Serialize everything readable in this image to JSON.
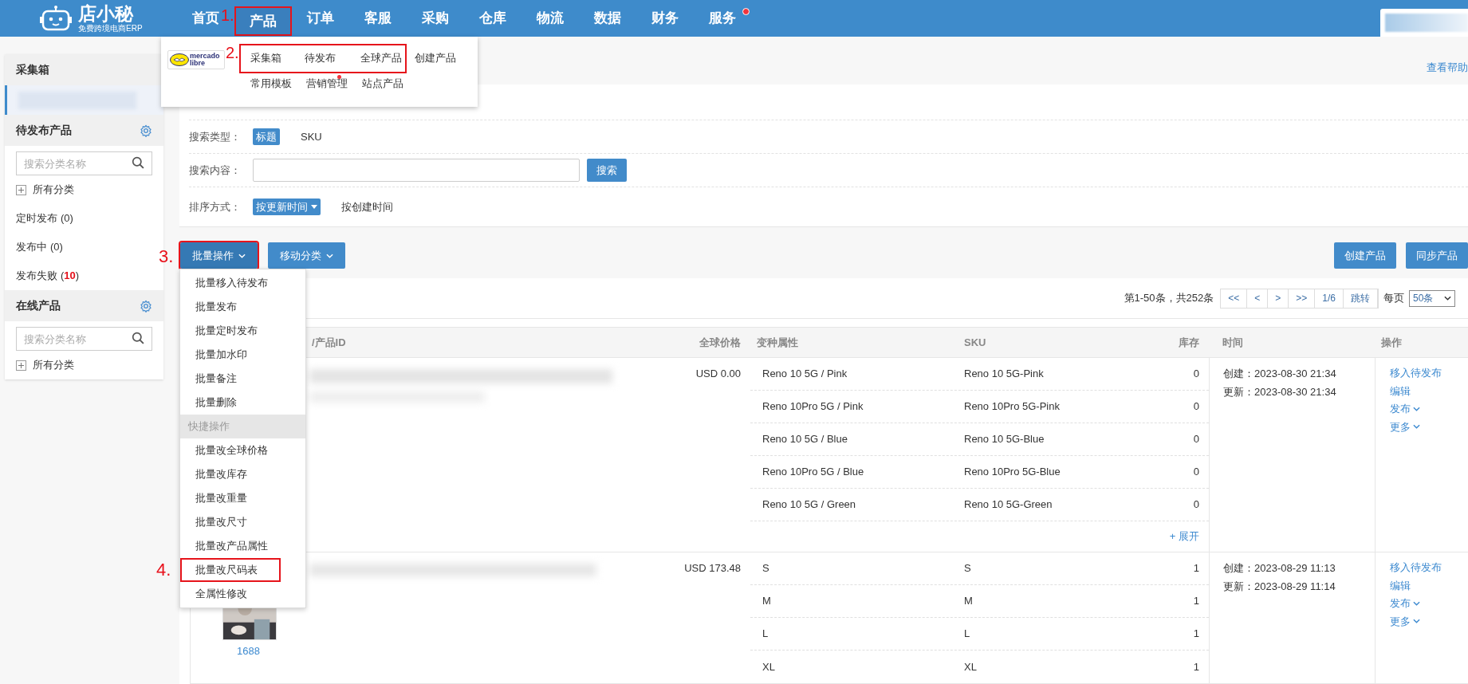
{
  "header": {
    "logo_name": "店小秘",
    "logo_tagline": "免费跨境电商ERP",
    "nav": [
      {
        "label": "首页",
        "selected": false,
        "highlighted": false,
        "badge": false
      },
      {
        "label": "产品",
        "selected": true,
        "highlighted": true,
        "badge": false,
        "annotation": "1."
      },
      {
        "label": "订单",
        "selected": false,
        "highlighted": false,
        "badge": false
      },
      {
        "label": "客服",
        "selected": false,
        "highlighted": false,
        "badge": false
      },
      {
        "label": "采购",
        "selected": false,
        "highlighted": false,
        "badge": false
      },
      {
        "label": "仓库",
        "selected": false,
        "highlighted": false,
        "badge": false
      },
      {
        "label": "物流",
        "selected": false,
        "highlighted": false,
        "badge": false
      },
      {
        "label": "数据",
        "selected": false,
        "highlighted": false,
        "badge": false
      },
      {
        "label": "财务",
        "selected": false,
        "highlighted": false,
        "badge": false
      },
      {
        "label": "服务",
        "selected": false,
        "highlighted": false,
        "badge": true
      }
    ]
  },
  "product_menu": {
    "platform_logo_text": "mercado libre",
    "annotation": "2.",
    "rows": [
      [
        {
          "label": "采集箱",
          "highlighted": true,
          "dot": false
        },
        {
          "label": "待发布",
          "highlighted": true,
          "dot": false
        },
        {
          "label": "全球产品",
          "highlighted": true,
          "dot": false
        },
        {
          "label": "创建产品",
          "highlighted": false,
          "dot": false
        }
      ],
      [
        {
          "label": "常用模板",
          "highlighted": false,
          "dot": false
        },
        {
          "label": "营销管理",
          "highlighted": false,
          "dot": true
        },
        {
          "label": "站点产品",
          "highlighted": false,
          "dot": false
        }
      ]
    ]
  },
  "sidebar": {
    "sections": [
      {
        "title": "采集箱",
        "settings": false
      },
      {
        "title": "待发布产品",
        "settings": true,
        "search_placeholder": "搜索分类名称",
        "tree_label": "所有分类",
        "expanded": false,
        "items": [
          {
            "label": "定时发布",
            "count": "(0)",
            "alert": false
          },
          {
            "label": "发布中",
            "count": "(0)",
            "alert": false
          },
          {
            "label": "发布失败",
            "count": "(10)",
            "alert": true
          }
        ]
      },
      {
        "title": "在线产品",
        "settings": true,
        "search_placeholder": "搜索分类名称",
        "tree_label": "所有分类",
        "expanded": false
      }
    ]
  },
  "help_link": "查看帮助",
  "filters": [
    {
      "kind": "options",
      "label": "搜索类型：",
      "options": [
        {
          "label": "标题",
          "selected": true,
          "caret": false
        },
        {
          "label": "SKU",
          "selected": false,
          "caret": false
        }
      ]
    },
    {
      "kind": "input",
      "label": "搜索内容：",
      "button": "搜索"
    },
    {
      "kind": "options",
      "label": "排序方式：",
      "options": [
        {
          "label": "按更新时间",
          "selected": true,
          "caret": true
        },
        {
          "label": "按创建时间",
          "selected": false,
          "caret": false
        }
      ]
    }
  ],
  "toolbar": {
    "left": [
      {
        "label": "批量操作",
        "caret": true,
        "highlighted": true,
        "annotation": "3."
      },
      {
        "label": "移动分类",
        "caret": true,
        "highlighted": false
      }
    ],
    "right": [
      {
        "label": "创建产品"
      },
      {
        "label": "同步产品"
      }
    ]
  },
  "batch_menu": [
    {
      "kind": "item",
      "label": "批量移入待发布",
      "highlighted": false
    },
    {
      "kind": "item",
      "label": "批量发布",
      "highlighted": false
    },
    {
      "kind": "item",
      "label": "批量定时发布",
      "highlighted": false
    },
    {
      "kind": "item",
      "label": "批量加水印",
      "highlighted": false
    },
    {
      "kind": "item",
      "label": "批量备注",
      "highlighted": false
    },
    {
      "kind": "item",
      "label": "批量删除",
      "highlighted": false
    },
    {
      "kind": "header",
      "label": "快捷操作",
      "highlighted": false
    },
    {
      "kind": "item",
      "label": "批量改全球价格",
      "highlighted": false
    },
    {
      "kind": "item",
      "label": "批量改库存",
      "highlighted": false
    },
    {
      "kind": "item",
      "label": "批量改重量",
      "highlighted": false
    },
    {
      "kind": "item",
      "label": "批量改尺寸",
      "highlighted": false
    },
    {
      "kind": "item",
      "label": "批量改产品属性",
      "highlighted": false
    },
    {
      "kind": "item",
      "label": "批量改尺码表",
      "highlighted": true,
      "annotation": "4."
    },
    {
      "kind": "item",
      "label": "全属性修改",
      "highlighted": false
    }
  ],
  "pagination": {
    "summary": "第1-50条，共252条",
    "buttons": [
      "<<",
      "<",
      ">",
      ">>",
      "1/6",
      "跳转"
    ],
    "per_page_label": "每页",
    "per_page": "50条"
  },
  "table": {
    "columns": [
      "/产品ID",
      "全球价格",
      "变种属性",
      "SKU",
      "库存",
      "时间",
      "操作"
    ],
    "rows": [
      {
        "price": "USD 0.00",
        "created": "创建：2023-08-30 21:34",
        "updated": "更新：2023-08-30 21:34",
        "expand": "+ 展开",
        "variants": [
          {
            "attr": "Reno 10 5G / Pink",
            "sku": "Reno 10 5G-Pink",
            "stock": "0"
          },
          {
            "attr": "Reno 10Pro 5G / Pink",
            "sku": "Reno 10Pro 5G-Pink",
            "stock": "0"
          },
          {
            "attr": "Reno 10 5G / Blue",
            "sku": "Reno 10 5G-Blue",
            "stock": "0"
          },
          {
            "attr": "Reno 10Pro 5G / Blue",
            "sku": "Reno 10Pro 5G-Blue",
            "stock": "0"
          },
          {
            "attr": "Reno 10 5G / Green",
            "sku": "Reno 10 5G-Green",
            "stock": "0"
          }
        ],
        "actions": [
          {
            "label": "移入待发布",
            "caret": false
          },
          {
            "label": "编辑",
            "caret": false
          },
          {
            "label": "发布",
            "caret": true
          },
          {
            "label": "更多",
            "caret": true
          }
        ]
      },
      {
        "price": "USD 173.48",
        "created": "创建：2023-08-29 11:13",
        "updated": "更新：2023-08-29 11:14",
        "source": "1688",
        "thumbnail": {
          "kind": "picture"
        },
        "variants": [
          {
            "attr": "S",
            "sku": "S",
            "stock": "1"
          },
          {
            "attr": "M",
            "sku": "M",
            "stock": "1"
          },
          {
            "attr": "L",
            "sku": "L",
            "stock": "1"
          },
          {
            "attr": "XL",
            "sku": "XL",
            "stock": "1"
          }
        ],
        "actions": [
          {
            "label": "移入待发布",
            "caret": false
          },
          {
            "label": "编辑",
            "caret": false
          },
          {
            "label": "发布",
            "caret": true
          },
          {
            "label": "更多",
            "caret": true
          }
        ]
      }
    ]
  }
}
